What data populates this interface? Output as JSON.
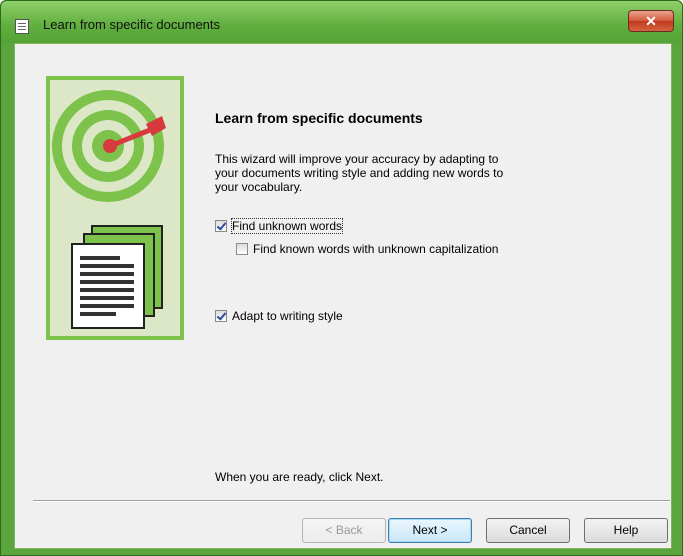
{
  "window": {
    "title": "Learn from specific documents",
    "close_glyph": "✕"
  },
  "main": {
    "heading": "Learn from specific documents",
    "intro": "This wizard will improve your accuracy by adapting to your documents writing style and adding new words to your vocabulary.",
    "options": [
      {
        "label": "Find unknown words",
        "checked": true
      },
      {
        "label": "Find known words with unknown capitalization",
        "checked": false
      },
      {
        "label": "Adapt to writing style",
        "checked": true
      }
    ],
    "ready_text": "When you are ready, click Next."
  },
  "buttons": {
    "back": "< Back",
    "next": "Next >",
    "cancel": "Cancel",
    "help": "Help"
  },
  "icons": {
    "title": "app-icon",
    "art": [
      "target-icon",
      "dart-icon",
      "documents-icon"
    ]
  },
  "colors": {
    "title_bar": "#5fae3e",
    "art_border": "#7cc24b",
    "art_bg": "#dbe7c6",
    "dart": "#d8393d"
  }
}
